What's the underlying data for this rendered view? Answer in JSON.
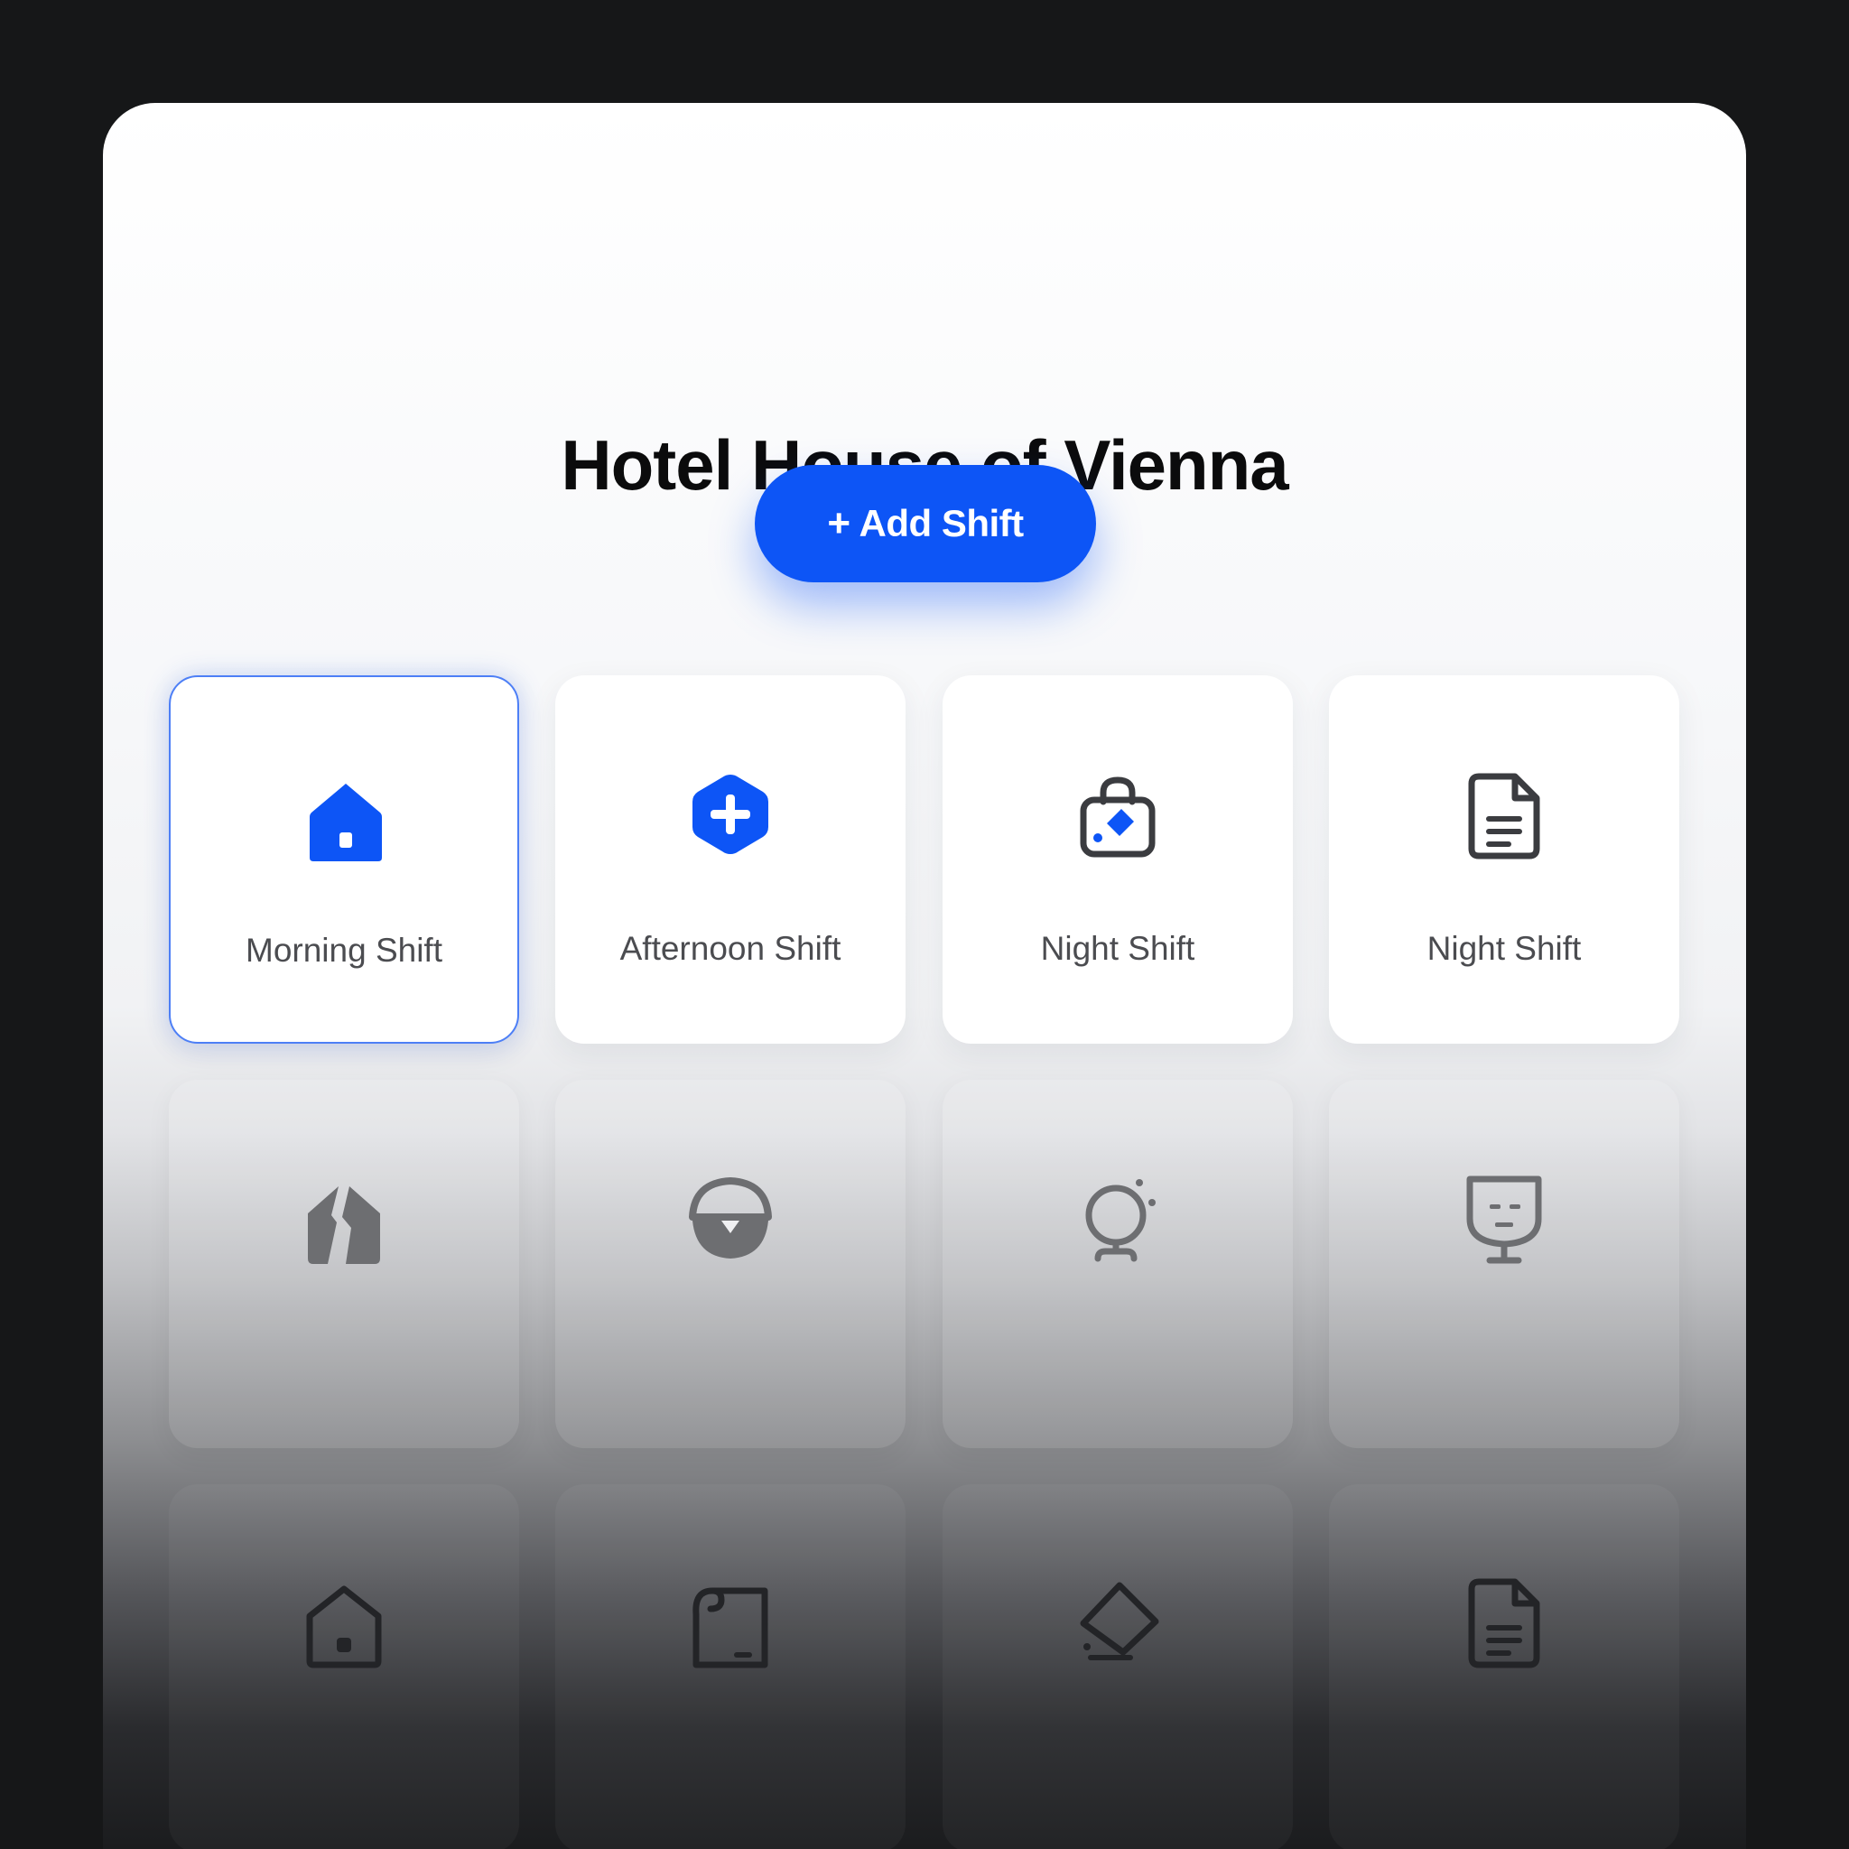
{
  "header": {
    "title": "Hotel House of Vienna"
  },
  "actions": {
    "add_shift_plus": "+",
    "add_shift_label": "Add Shift"
  },
  "shifts": [
    {
      "label": "Morning Shift",
      "icon": "house-icon",
      "selected": true
    },
    {
      "label": "Afternoon Shift",
      "icon": "plus-hexagon-icon",
      "selected": false
    },
    {
      "label": "Night Shift",
      "icon": "bag-icon",
      "selected": false
    },
    {
      "label": "Night Shift",
      "icon": "document-icon",
      "selected": false
    }
  ],
  "placeholder_icons_row2": [
    "split-house-icon",
    "half-circle-icon",
    "bulb-icon",
    "glass-face-icon"
  ],
  "placeholder_icons_row3": [
    "house-outline-icon",
    "frame-icon",
    "diamond-icon",
    "document-outline-icon"
  ],
  "colors": {
    "accent": "#0d55f6",
    "icon_dark": "#3b3c40",
    "icon_muted": "#6d6e71",
    "icon_faded": "#232427",
    "label": "#4b4c50",
    "backdrop": "#161718"
  }
}
